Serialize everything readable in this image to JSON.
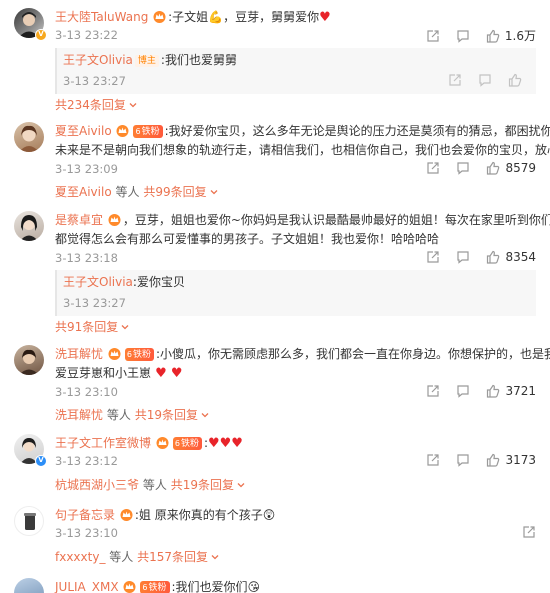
{
  "comments": [
    {
      "username": "王大陸TaluWang",
      "text_prefix": ":子文姐",
      "text_middle": "，豆芽，舅舅爱你",
      "time": "3-13 23:22",
      "like_count": "1.6万",
      "reply": {
        "username": "王子文Olivia",
        "badge": "博主",
        "text": ":我们也爱舅舅",
        "time": "3-13 23:27"
      },
      "more": "共234条回复"
    },
    {
      "username": "夏至Aivilo",
      "fan_badge": "铁粉",
      "fan_level": "6",
      "line1": ":我好爱你宝贝，这么多年无论是舆论的压力还是莫须有的猜忌，都困扰你太久了，不管",
      "line2": "未来是不是朝向我们想象的轨迹行走，请相信我们，也相信你自己，我们也会爱你的宝贝，放心",
      "time": "3-13 23:09",
      "like_count": "8579",
      "more_name": "夏至Aivilo",
      "more_mid": "等人",
      "more_count": "共99条回复"
    },
    {
      "username": "是蔡卓宜",
      "line1": "，豆芽，姐姐也爱你~你妈妈是我认识最酷最帅最好的姐姐！每次在家里听到你们打电话~我",
      "line2": "都觉得怎么会有那么可爱懂事的男孩子。子文姐姐！我也爱你！哈哈哈哈",
      "time": "3-13 23:18",
      "like_count": "8354",
      "reply": {
        "username": "王子文Olivia",
        "text": ":爱你宝贝",
        "time": "3-13 23:27"
      },
      "more": "共91条回复"
    },
    {
      "username": "洗耳解忧",
      "fan_badge": "铁粉",
      "fan_level": "6",
      "line1": ":小傻瓜，你无需顾虑那么多，我们都会一直在你身边。你想保护的，也是我们所想。我",
      "line2": "爱豆芽崽和小王崽",
      "time": "3-13 23:10",
      "like_count": "3721",
      "more_name": "洗耳解忧",
      "more_mid": "等人",
      "more_count": "共19条回复"
    },
    {
      "username": "王子文工作室微博",
      "fan_badge": "铁粉",
      "fan_level": "6",
      "text": ":",
      "time": "3-13 23:12",
      "like_count": "3173",
      "more_name": "杭城西湖小三爷",
      "more_mid": "等人",
      "more_count": "共19条回复"
    },
    {
      "username": "句子备忘录",
      "text": ":姐 原来你真的有个孩子",
      "time": "3-13 23:10",
      "more_name": "fxxxxty_",
      "more_mid": "等人",
      "more_count": "共157条回复"
    },
    {
      "username": "JULIA_XMX",
      "fan_badge": "铁粉",
      "fan_level": "6",
      "text": ":我们也爱你们"
    }
  ],
  "colors": {
    "username": "#eb7350",
    "meta": "#999999",
    "heart": "#e8242a",
    "fan_badge": "#ff6a36"
  },
  "icons": [
    "share-icon",
    "comment-icon",
    "like-icon",
    "crown-icon",
    "heart-icon",
    "chevron-down-icon"
  ]
}
